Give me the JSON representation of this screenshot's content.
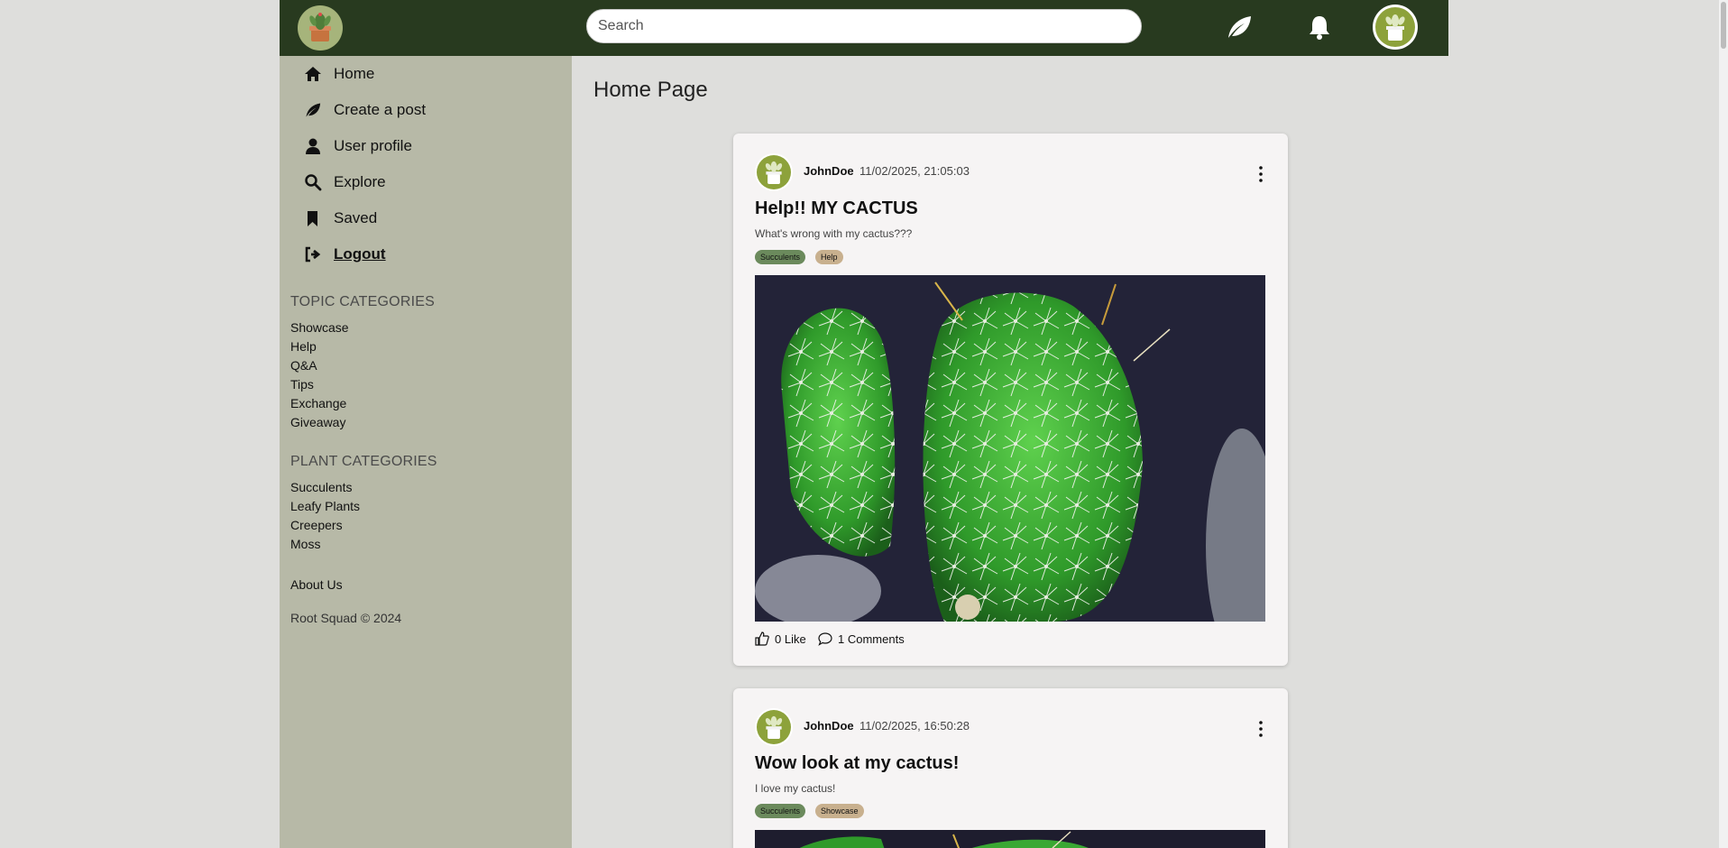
{
  "header": {
    "search_placeholder": "Search",
    "icons": [
      "app-logo",
      "leaf-icon",
      "bell-icon",
      "user-avatar"
    ]
  },
  "sidebar": {
    "nav": [
      {
        "label": "Home",
        "icon": "home-icon"
      },
      {
        "label": "Create a post",
        "icon": "leaf-icon"
      },
      {
        "label": "User profile",
        "icon": "user-icon"
      },
      {
        "label": "Explore",
        "icon": "search-icon"
      },
      {
        "label": "Saved",
        "icon": "bookmark-icon"
      },
      {
        "label": "Logout",
        "icon": "logout-icon"
      }
    ],
    "topic_title": "TOPIC CATEGORIES",
    "topics": [
      "Showcase",
      "Help",
      "Q&A",
      "Tips",
      "Exchange",
      "Giveaway"
    ],
    "plant_title": "PLANT CATEGORIES",
    "plants": [
      "Succulents",
      "Leafy Plants",
      "Creepers",
      "Moss"
    ],
    "about": "About Us",
    "copyright": "Root Squad © 2024"
  },
  "main": {
    "page_title": "Home Page",
    "posts": [
      {
        "user": "JohnDoe",
        "time": "11/02/2025, 21:05:03",
        "title": "Help!! MY CACTUS",
        "desc": "What's wrong with my cactus???",
        "tags": [
          "Succulents",
          "Help"
        ],
        "likes": "0 Like",
        "comments": "1 Comments"
      },
      {
        "user": "JohnDoe",
        "time": "11/02/2025, 16:50:28",
        "title": "Wow look at my cactus!",
        "desc": "I love my cactus!",
        "tags": [
          "Succulents",
          "Showcase"
        ]
      }
    ]
  },
  "colors": {
    "header_bg": "#283a1f",
    "sidebar_bg": "#b7b9a7",
    "page_bg": "#dededc",
    "tag_green": "#6b8a5c",
    "tag_tan": "#c8b08e"
  }
}
